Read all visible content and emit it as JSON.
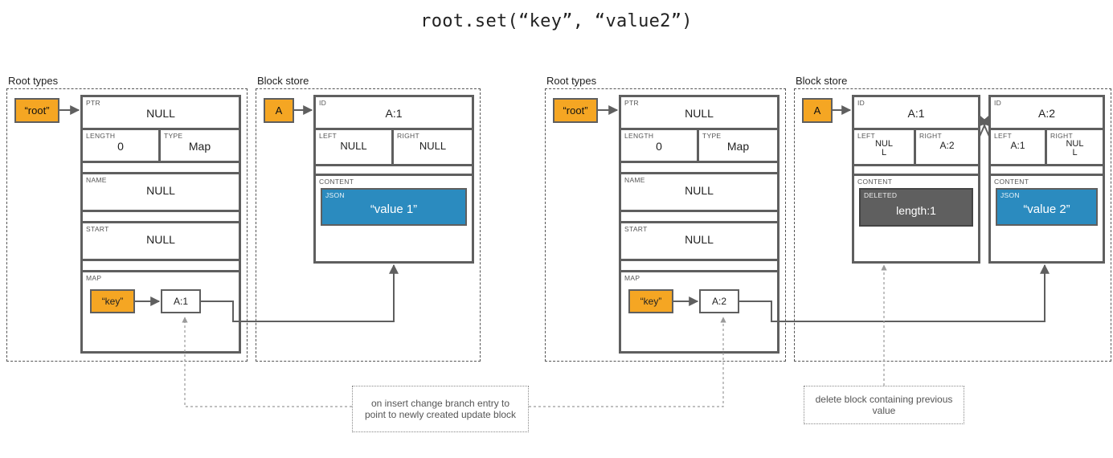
{
  "title": "root.set(“key”, “value2”)",
  "labels": {
    "root_types": "Root types",
    "block_store": "Block store",
    "ptr": "PTR",
    "length": "LENGTH",
    "type": "TYPE",
    "name": "NAME",
    "start": "START",
    "map": "MAP",
    "id": "ID",
    "left_lbl": "LEFT",
    "right_lbl": "RIGHT",
    "content": "CONTENT",
    "json": "JSON",
    "deleted": "DELETED"
  },
  "tags": {
    "root": "“root”",
    "A": "A",
    "key": "“key”"
  },
  "null_txt": "NULL",
  "null_txt_wrap": "NUL\nL",
  "left": {
    "root": {
      "ptr": "NULL",
      "length": "0",
      "type": "Map",
      "name": "NULL",
      "start": "NULL",
      "map_key": "“key”",
      "map_val": "A:1"
    },
    "block": {
      "id": "A:1",
      "left": "NULL",
      "right": "NULL",
      "content_json": "“value 1”"
    }
  },
  "right": {
    "root": {
      "ptr": "NULL",
      "length": "0",
      "type": "Map",
      "name": "NULL",
      "start": "NULL",
      "map_key": "“key”",
      "map_val": "A:2"
    },
    "blockA1": {
      "id": "A:1",
      "left": "NUL\nL",
      "right": "A:2",
      "deleted_val": "length:1"
    },
    "blockA2": {
      "id": "A:2",
      "left": "A:1",
      "right": "NUL\nL",
      "content_json": "“value 2”"
    }
  },
  "notes": {
    "insert": "on insert change branch entry to point to newly created update block",
    "delete": "delete block containing previous value"
  }
}
